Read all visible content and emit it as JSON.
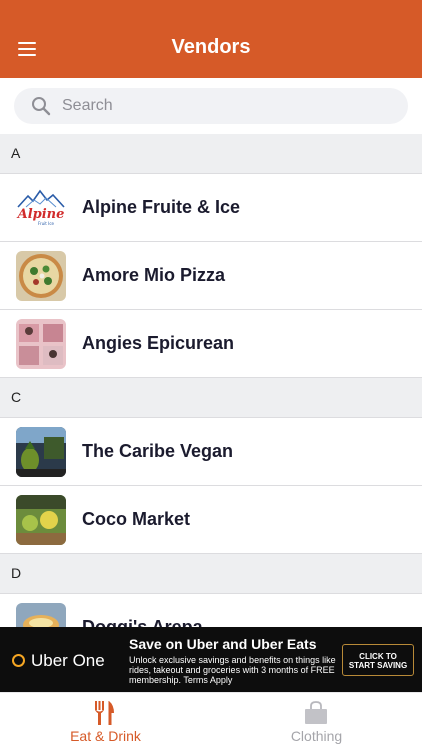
{
  "header": {
    "title": "Vendors",
    "menu_icon": "hamburger-menu-icon"
  },
  "search": {
    "placeholder": "Search",
    "icon": "search-icon"
  },
  "sections": [
    {
      "letter": "A",
      "vendors": [
        "Alpine Fruite & Ice",
        "Amore Mio Pizza",
        "Angies Epicurean"
      ]
    },
    {
      "letter": "C",
      "vendors": [
        "The Caribe Vegan",
        "Coco Market"
      ]
    },
    {
      "letter": "D",
      "vendors": [
        "Doggi's Arepa"
      ]
    }
  ],
  "thumb_logo_text": {
    "brand": "Alpine",
    "sub": "Fruit Ice"
  },
  "ad": {
    "logo_text": "Uber One",
    "headline": "Save on Uber and Uber Eats",
    "body": "Unlock exclusive savings and benefits on things like rides, takeout and groceries with 3 months of FREE membership. Terms Apply",
    "cta_line1": "CLICK TO",
    "cta_line2": "START SAVING"
  },
  "tabs": [
    {
      "label": "Eat & Drink",
      "icon": "fork-knife-icon",
      "active": true
    },
    {
      "label": "Clothing",
      "icon": "shopping-bag-icon",
      "active": false
    }
  ],
  "colors": {
    "brand": "#d65a28",
    "section_bg": "#eeeff1",
    "ad_bg": "#0d0d0d",
    "inactive_tab": "#a5a5aa"
  }
}
